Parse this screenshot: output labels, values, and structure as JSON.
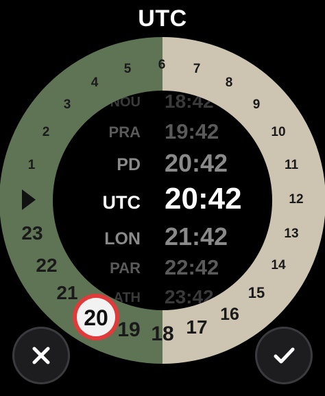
{
  "header": {
    "title": "UTC"
  },
  "dial": {
    "hours_left": [
      {
        "id": "1",
        "label": "1"
      },
      {
        "id": "2",
        "label": "2"
      },
      {
        "id": "3",
        "label": "3"
      },
      {
        "id": "4",
        "label": "4"
      },
      {
        "id": "5",
        "label": "5"
      },
      {
        "id": "21",
        "label": "21"
      },
      {
        "id": "22",
        "label": "22"
      },
      {
        "id": "23",
        "label": "23"
      }
    ],
    "hours_right": [
      {
        "id": "6",
        "label": "6"
      },
      {
        "id": "7",
        "label": "7"
      },
      {
        "id": "8",
        "label": "8"
      },
      {
        "id": "9",
        "label": "9"
      },
      {
        "id": "10",
        "label": "10"
      },
      {
        "id": "11",
        "label": "11"
      },
      {
        "id": "12",
        "label": "12"
      },
      {
        "id": "13",
        "label": "13"
      },
      {
        "id": "14",
        "label": "14"
      },
      {
        "id": "15",
        "label": "15"
      },
      {
        "id": "16",
        "label": "16"
      },
      {
        "id": "17",
        "label": "17"
      },
      {
        "id": "18",
        "label": "18"
      },
      {
        "id": "19",
        "label": "19"
      }
    ],
    "selected_hour": "20",
    "colors": {
      "left": "#5f7355",
      "right": "#cdc5b2",
      "selector": "#e03a3a"
    }
  },
  "zones": [
    {
      "code": "NOU",
      "time": "18:42"
    },
    {
      "code": "PRA",
      "time": "19:42"
    },
    {
      "code": "PD",
      "time": "20:42"
    },
    {
      "code": "UTC",
      "time": "20:42"
    },
    {
      "code": "LON",
      "time": "21:42"
    },
    {
      "code": "PAR",
      "time": "22:42"
    },
    {
      "code": "ATH",
      "time": "23:42"
    }
  ],
  "controls": {
    "cancel_icon": "close-icon",
    "confirm_icon": "checkmark-icon"
  }
}
